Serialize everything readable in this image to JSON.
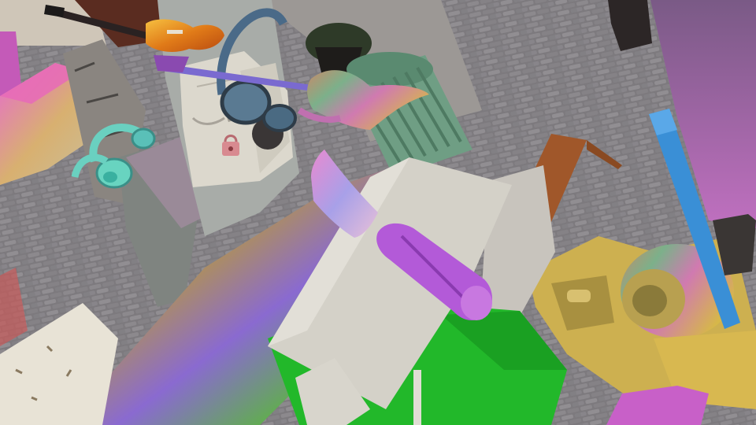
{
  "scene": {
    "objects": [
      {
        "name": "electric-guitar",
        "icon": "guitar-icon"
      },
      {
        "name": "bass-guitar",
        "icon": "guitar-icon"
      },
      {
        "name": "headphones",
        "icon": "headphones-icon"
      },
      {
        "name": "backpack",
        "icon": "backpack-icon"
      },
      {
        "name": "padlock",
        "icon": "lock-icon"
      },
      {
        "name": "trash-can",
        "icon": "trash-icon"
      },
      {
        "name": "putty-knife",
        "icon": "knife-icon"
      },
      {
        "name": "wooden-chair",
        "icon": "chair-icon"
      },
      {
        "name": "tape-dispenser",
        "icon": "tape-icon"
      },
      {
        "name": "blue-beam",
        "icon": "beam-icon"
      }
    ],
    "colors": {
      "cobblestone": "#7d7a7e",
      "wall": "#9c9895",
      "green_block": "#22b82a",
      "gray_block": "#d4d1c8",
      "blue_beam": "#3a8fd6",
      "trash_can": "#6f9e84",
      "chair_wood": "#a0572a",
      "knife_handle": "#b35ad8"
    }
  }
}
